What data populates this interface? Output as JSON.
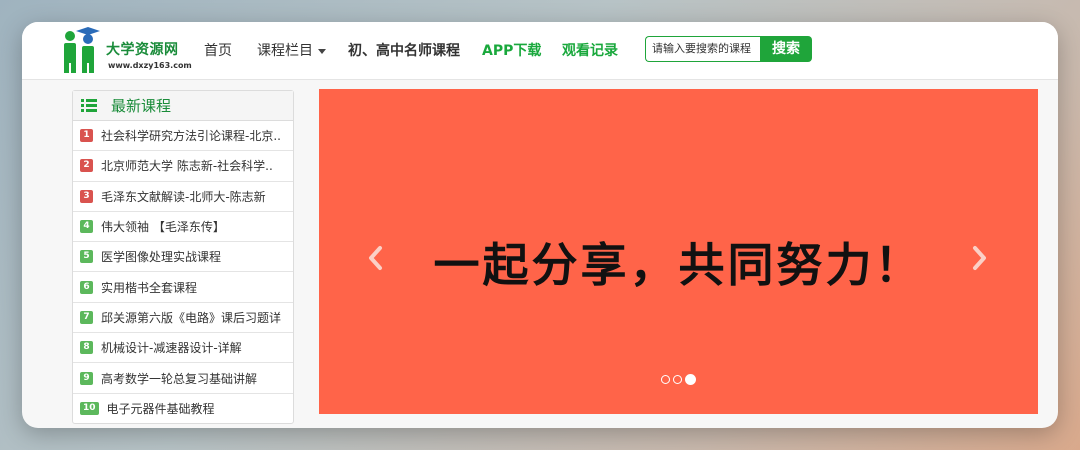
{
  "header": {
    "logo_text": "大学资源网",
    "logo_url": "www.dxzy163.com",
    "nav": [
      {
        "label": "首页"
      },
      {
        "label": "课程栏目"
      },
      {
        "label": "初、高中名师课程"
      },
      {
        "label": "APP下载"
      },
      {
        "label": "观看记录"
      }
    ],
    "search": {
      "placeholder": "请输入要搜索的课程",
      "button_label": "搜索"
    }
  },
  "sidebar": {
    "title": "最新课程",
    "items": [
      {
        "rank": "1",
        "label": "社会科学研究方法引论课程-北京.."
      },
      {
        "rank": "2",
        "label": "北京师范大学 陈志新-社会科学.."
      },
      {
        "rank": "3",
        "label": "毛泽东文献解读-北师大-陈志新"
      },
      {
        "rank": "4",
        "label": "伟大领袖 【毛泽东传】"
      },
      {
        "rank": "5",
        "label": "医学图像处理实战课程"
      },
      {
        "rank": "6",
        "label": "实用楷书全套课程"
      },
      {
        "rank": "7",
        "label": "邱关源第六版《电路》课后习题详"
      },
      {
        "rank": "8",
        "label": "机械设计-减速器设计-详解"
      },
      {
        "rank": "9",
        "label": "高考数学一轮总复习基础讲解"
      },
      {
        "rank": "10",
        "label": "电子元器件基础教程"
      }
    ]
  },
  "carousel": {
    "slide_text": "一起分享，共同努力！",
    "background": "#ff6449",
    "active_index": 3,
    "count": 3
  },
  "colors": {
    "brand_green": "#1fa53a",
    "badge_red": "#d9534f",
    "badge_green": "#5cb85c"
  }
}
